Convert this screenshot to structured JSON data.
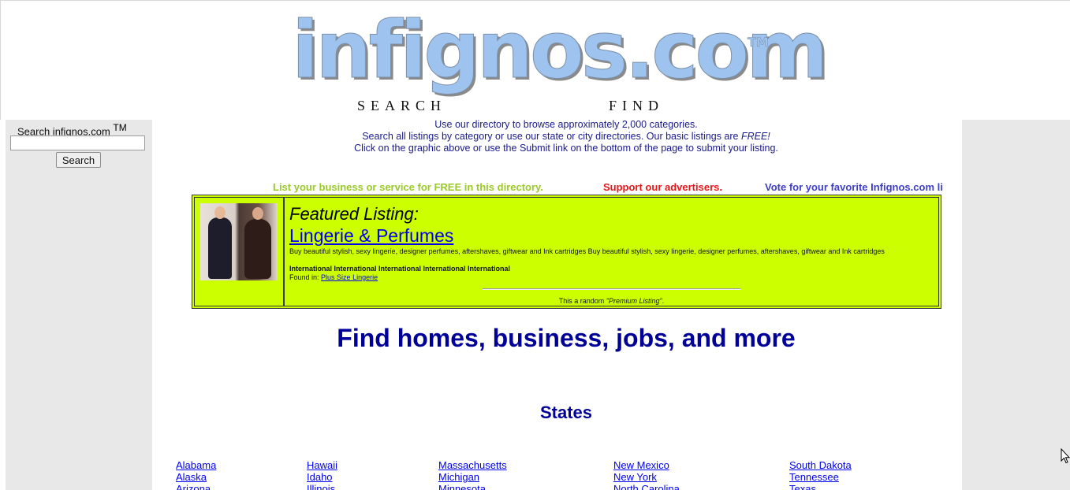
{
  "header": {
    "logo_text": "infignos.com",
    "logo_tm": "TM",
    "tagline_left": "SEARCH",
    "tagline_right": "FIND"
  },
  "sidebar": {
    "search_label": "Search infignos.com",
    "search_tm": "TM",
    "search_value": "",
    "search_button": "Search"
  },
  "intro": {
    "line1": "Use our directory to browse approximately 2,000 categories.",
    "line2_start": "Search all listings by category or use our state or city directories. Our basic listings are ",
    "line2_emph": "FREE!",
    "line3": "Click on the graphic above or use the Submit link on the bottom of the page to submit your listing."
  },
  "marquee": {
    "item1": "List your business or service for FREE in this directory.",
    "item2": "Support our advertisers.",
    "item3": "Vote for your favorite Infignos.com li"
  },
  "featured": {
    "heading": "Featured Listing:",
    "title": "Lingerie & Perfumes",
    "description": "Buy beautiful stylish, sexy lingerie, designer perfumes, aftershaves, giftwear and Ink cartridges Buy beautiful stylish, sexy lingerie, designer perfumes, aftershaves, giftwear and Ink cartridges",
    "regions": "International International International International International",
    "found_in_label": "Found in:",
    "found_in_link": "Plus Size Lingerie",
    "random_prefix": "This a random ",
    "random_emph": "\"Premium Listing\"",
    "random_suffix": "."
  },
  "main": {
    "heading": "Find homes, business, jobs, and more",
    "states_heading": "States"
  },
  "states": [
    [
      "Alabama",
      "Alaska",
      "Arizona"
    ],
    [
      "Hawaii",
      "Idaho",
      "Illinois"
    ],
    [
      "Massachusetts",
      "Michigan",
      "Minnesota"
    ],
    [
      "New Mexico",
      "New York",
      "North Carolina"
    ],
    [
      "South Dakota",
      "Tennessee",
      "Texas"
    ]
  ],
  "colors": {
    "featured_bg": "#ccff00",
    "heading_blue": "#000099",
    "link_blue": "#0000ee",
    "logo_blue": "#9ec3ee"
  }
}
